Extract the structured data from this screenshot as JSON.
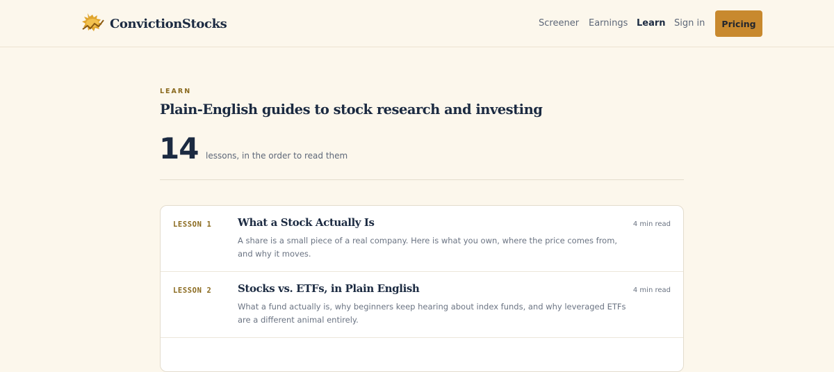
{
  "header": {
    "brand": "ConvictionStocks",
    "nav": [
      {
        "label": "Screener",
        "active": false
      },
      {
        "label": "Earnings",
        "active": false
      },
      {
        "label": "Learn",
        "active": true
      },
      {
        "label": "Sign in",
        "active": false
      }
    ],
    "cta_label": "Pricing",
    "logo_icon": "bull-icon"
  },
  "intro": {
    "eyebrow": "LEARN",
    "title": "Plain-English guides to stock research and investing",
    "count": "14",
    "count_label": "lessons, in the order to read them"
  },
  "lessons": [
    {
      "number": "LESSON 1",
      "title": "What a Stock Actually Is",
      "description": "A share is a small piece of a real company. Here is what you own, where the price comes from, and why it moves.",
      "read_time": "4 min read"
    },
    {
      "number": "LESSON 2",
      "title": "Stocks vs. ETFs, in Plain English",
      "description": "What a fund actually is, why beginners keep hearing about index funds, and why leveraged ETFs are a different animal entirely.",
      "read_time": "4 min read"
    }
  ],
  "colors": {
    "background": "#fcf7ec",
    "accent": "#c8892e",
    "text": "#1b2a41",
    "muted": "#6a7382"
  }
}
